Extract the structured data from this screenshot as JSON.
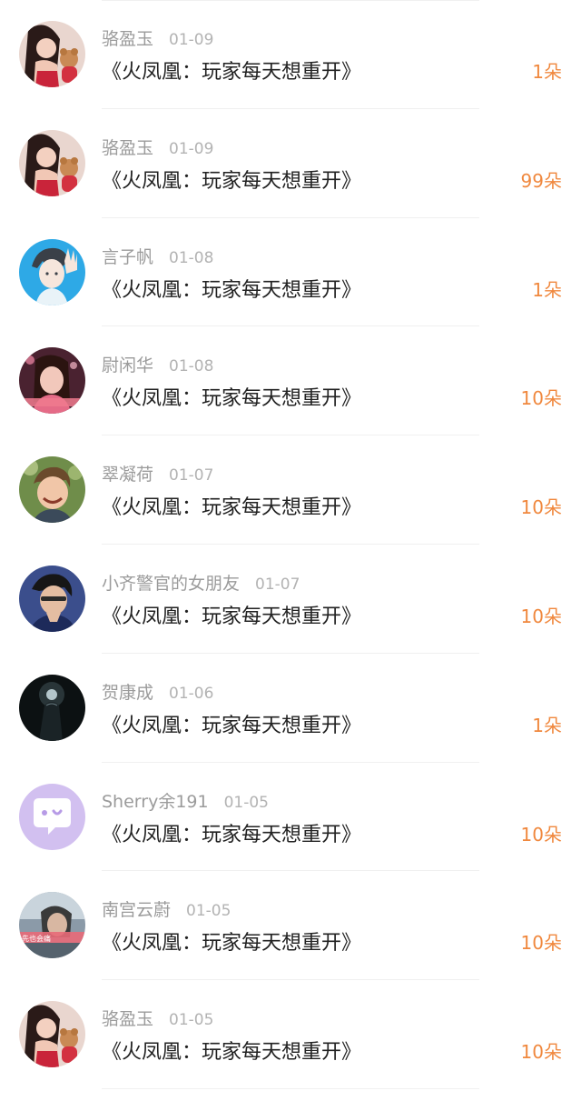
{
  "colors": {
    "name": "#9b9b9b",
    "date": "#b3b3b3",
    "title": "#222222",
    "amount": "#f0883e",
    "divider": "#f0f0f0"
  },
  "records": [
    {
      "name": "骆盈玉",
      "date": "01-09",
      "title": "《火凤凰：玩家每天想重开》",
      "amount": "1朵",
      "avatar": "avatar-girl-with-teddy"
    },
    {
      "name": "骆盈玉",
      "date": "01-09",
      "title": "《火凤凰：玩家每天想重开》",
      "amount": "99朵",
      "avatar": "avatar-girl-with-teddy"
    },
    {
      "name": "言子帆",
      "date": "01-08",
      "title": "《火凤凰：玩家每天想重开》",
      "amount": "1朵",
      "avatar": "avatar-anime-boy"
    },
    {
      "name": "尉闲华",
      "date": "01-08",
      "title": "《火凤凰：玩家每天想重开》",
      "amount": "10朵",
      "avatar": "avatar-girl-pink"
    },
    {
      "name": "翠凝荷",
      "date": "01-07",
      "title": "《火凤凰：玩家每天想重开》",
      "amount": "10朵",
      "avatar": "avatar-smiling-child"
    },
    {
      "name": "小齐警官的女朋友",
      "date": "01-07",
      "title": "《火凤凰：玩家每天想重开》",
      "amount": "10朵",
      "avatar": "avatar-man-blue"
    },
    {
      "name": "贺康成",
      "date": "01-06",
      "title": "《火凤凰：玩家每天想重开》",
      "amount": "1朵",
      "avatar": "avatar-dark-silhouette"
    },
    {
      "name": "Sherry余191",
      "date": "01-05",
      "title": "《火凤凰：玩家每天想重开》",
      "amount": "10朵",
      "avatar": "avatar-chat-bubble"
    },
    {
      "name": "南宫云蔚",
      "date": "01-05",
      "title": "《火凤凰：玩家每天想重开》",
      "amount": "10朵",
      "avatar": "avatar-photo-caption"
    },
    {
      "name": "骆盈玉",
      "date": "01-05",
      "title": "《火凤凰：玩家每天想重开》",
      "amount": "10朵",
      "avatar": "avatar-girl-with-teddy"
    }
  ],
  "avatar_captions": {
    "avatar-photo-caption": "先也会痛"
  }
}
